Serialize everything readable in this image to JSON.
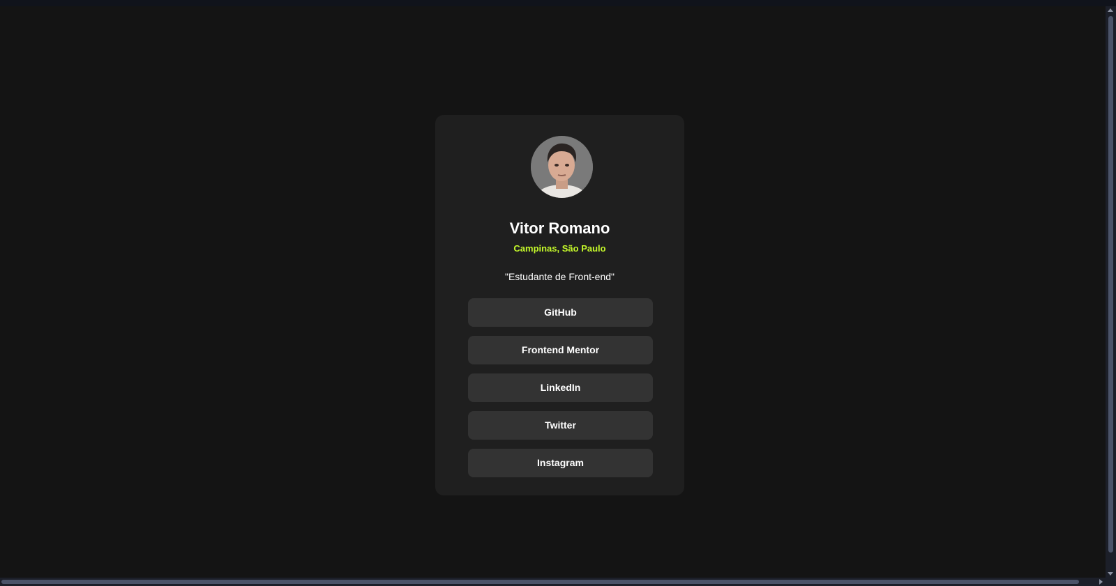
{
  "profile": {
    "name": "Vitor Romano",
    "location": "Campinas, São Paulo",
    "bio": "\"Estudante de Front-end\"",
    "avatar_icon": "avatar-photo"
  },
  "links": [
    {
      "label": "GitHub"
    },
    {
      "label": "Frontend Mentor"
    },
    {
      "label": "LinkedIn"
    },
    {
      "label": "Twitter"
    },
    {
      "label": "Instagram"
    }
  ],
  "colors": {
    "background": "#141414",
    "card": "#1f1f1f",
    "button": "#333333",
    "accent": "#c4f82a",
    "text": "#ffffff"
  }
}
